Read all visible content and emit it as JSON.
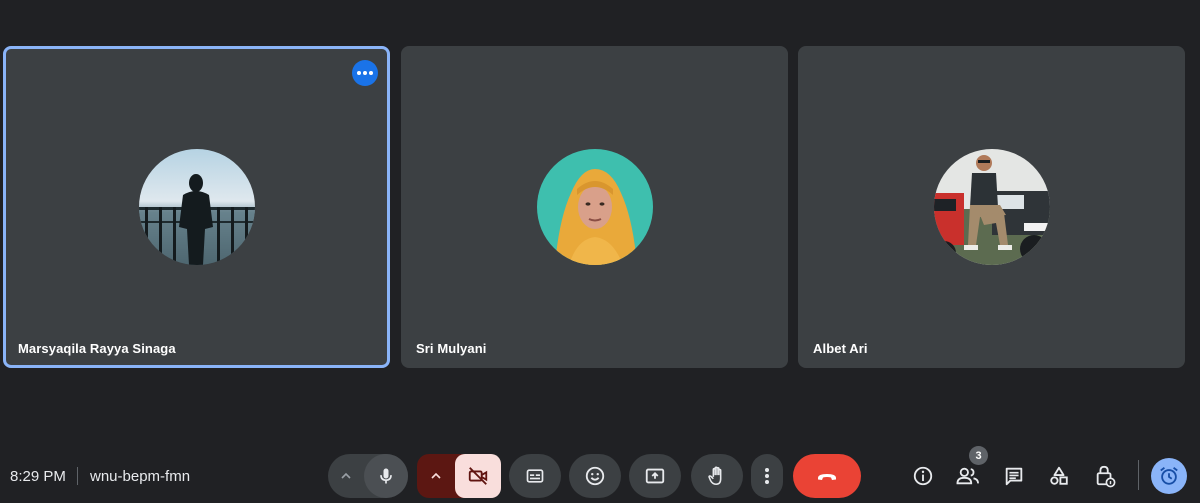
{
  "participants": [
    {
      "name": "Marsyaqila Rayya Sinaga",
      "active": true
    },
    {
      "name": "Sri Mulyani",
      "active": false
    },
    {
      "name": "Albet Ari",
      "active": false
    }
  ],
  "meeting": {
    "time": "8:29 PM",
    "code": "wnu-bepm-fmn",
    "participant_count": "3"
  },
  "icons": {
    "more": "more-options-icon",
    "mic": "microphone-icon",
    "camera_off": "camera-off-icon",
    "captions": "captions-icon",
    "emoji": "emoji-icon",
    "present": "present-screen-icon",
    "hand": "raise-hand-icon",
    "more_vert": "more-vert-icon",
    "leave": "leave-call-icon",
    "info": "info-icon",
    "people": "people-icon",
    "chat": "chat-icon",
    "activities": "activities-icon",
    "host_controls": "host-controls-lock-icon",
    "companion": "companion-alarm-icon"
  },
  "colors": {
    "background": "#202124",
    "tile": "#3c4043",
    "active_border": "#8ab4f8",
    "leave": "#ea4335",
    "camera_off_bg": "#f9dedc",
    "camera_group_bg": "#5c1712"
  }
}
